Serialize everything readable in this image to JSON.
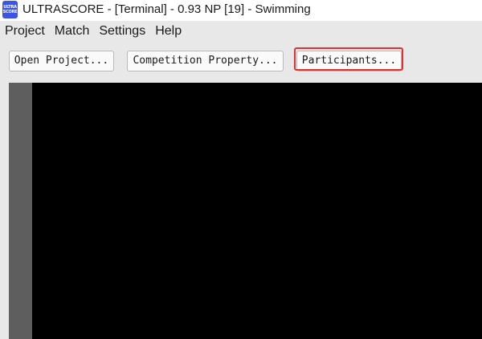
{
  "window": {
    "icon_line1": "ULTRA",
    "icon_line2": "SCORE",
    "title": "ULTRASCORE - [Terminal] - 0.93 NP [19] - Swimming"
  },
  "menu": {
    "items": [
      "Project",
      "Match",
      "Settings",
      "Help"
    ]
  },
  "toolbar": {
    "open_project_label": "Open Project...",
    "competition_property_label": "Competition Property...",
    "participants_label": "Participants..."
  },
  "colors": {
    "highlight": "#e03030",
    "app_icon": "#3a54e6",
    "content_background": "#000000",
    "side_strip": "#5e5e5e"
  }
}
